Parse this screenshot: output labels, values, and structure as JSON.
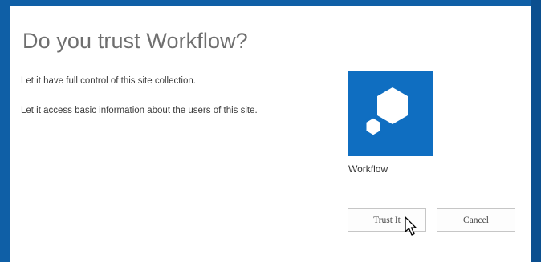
{
  "dialog": {
    "title": "Do you trust Workflow?",
    "permissions": [
      "Let it have full control of this site collection.",
      "Let it access basic information about the users of this site."
    ]
  },
  "app": {
    "name": "Workflow",
    "icon": "workflow-hexagon-icon",
    "tile_color": "#0f6ec1"
  },
  "buttons": {
    "trust_label": "Trust It",
    "cancel_label": "Cancel"
  },
  "colors": {
    "frame": "#0f5fa6",
    "dialog_background": "#ffffff",
    "title_text": "#6f6f6f"
  }
}
